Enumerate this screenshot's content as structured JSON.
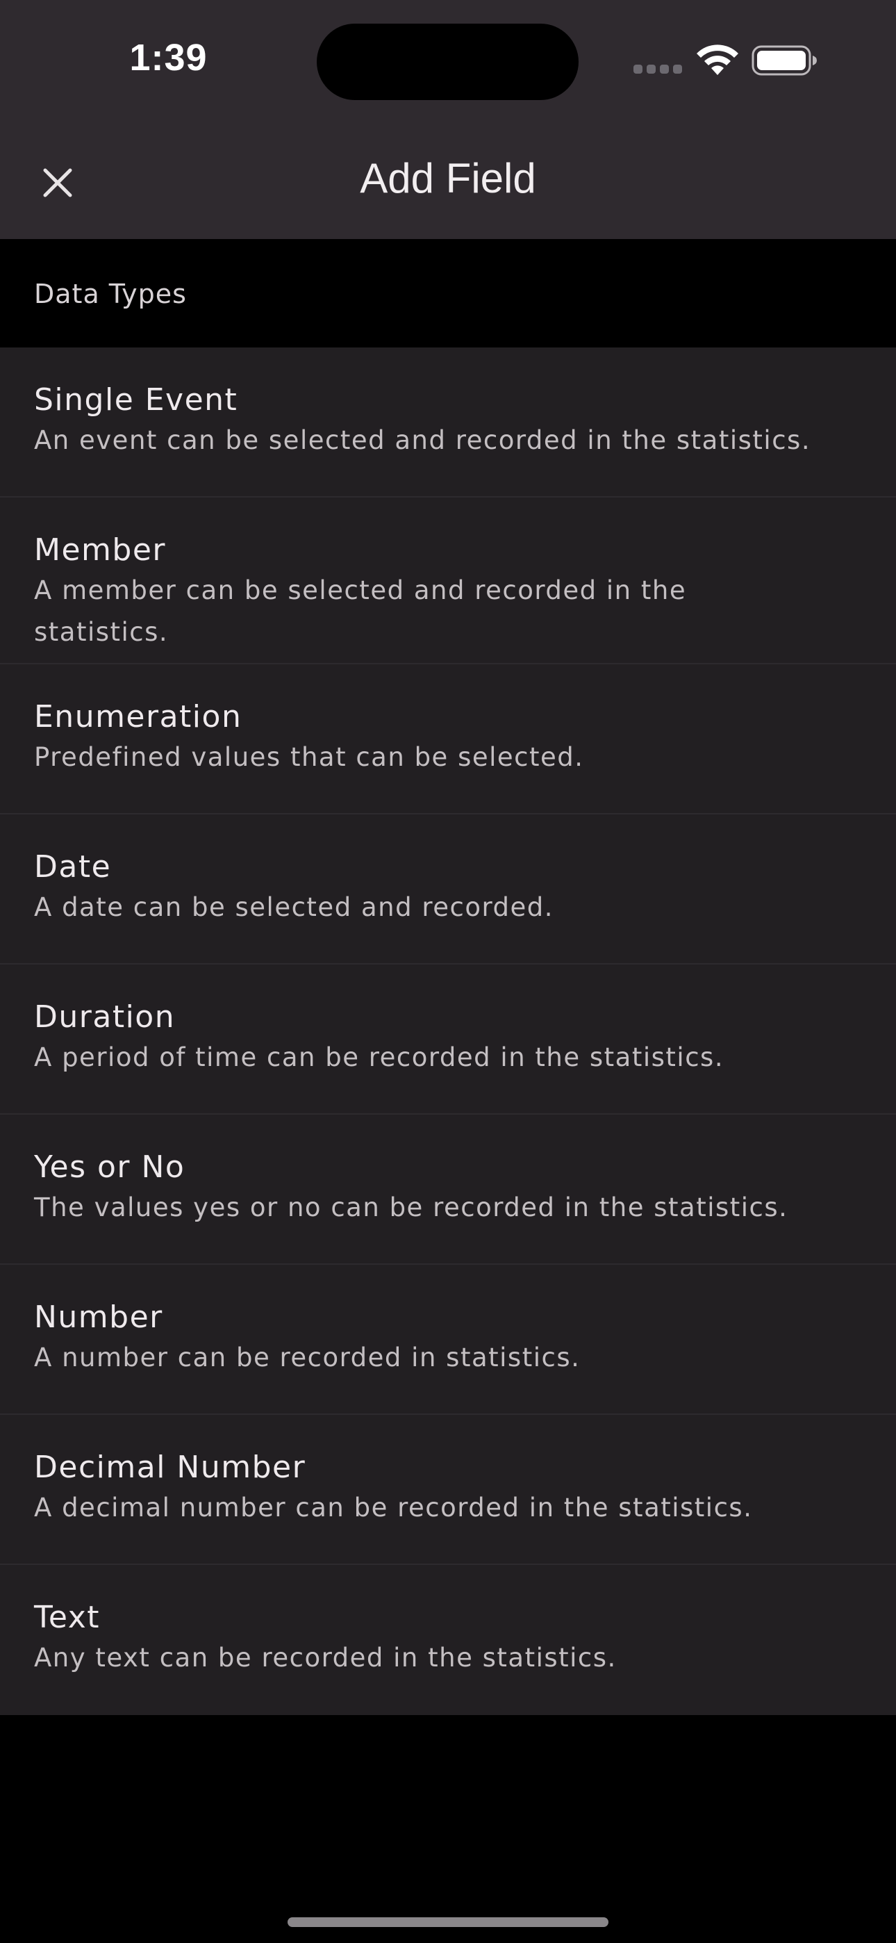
{
  "status_bar": {
    "time": "1:39",
    "icons": [
      "cellular-signal-icon",
      "wifi-icon",
      "battery-icon"
    ]
  },
  "nav": {
    "title": "Add Field",
    "close_icon": "close-icon"
  },
  "section": {
    "header": "Data Types"
  },
  "items": [
    {
      "title": "Single Event",
      "description": "An event can be selected and recorded in the statistics."
    },
    {
      "title": "Member",
      "description": "A member can be selected and recorded in the statistics."
    },
    {
      "title": "Enumeration",
      "description": "Predefined values that can be selected."
    },
    {
      "title": "Date",
      "description": "A date can be selected and recorded."
    },
    {
      "title": "Duration",
      "description": "A period of time can be recorded in the statistics."
    },
    {
      "title": "Yes or No",
      "description": "The values yes or no can be recorded in the statistics."
    },
    {
      "title": "Number",
      "description": "A number can be recorded in statistics."
    },
    {
      "title": "Decimal Number",
      "description": "A decimal number can be recorded in the statistics."
    },
    {
      "title": "Text",
      "description": "Any text can be recorded in the statistics."
    }
  ],
  "colors": {
    "navbar_bg": "#2f2a2f",
    "list_bg": "#221f22",
    "page_bg": "#000000"
  }
}
